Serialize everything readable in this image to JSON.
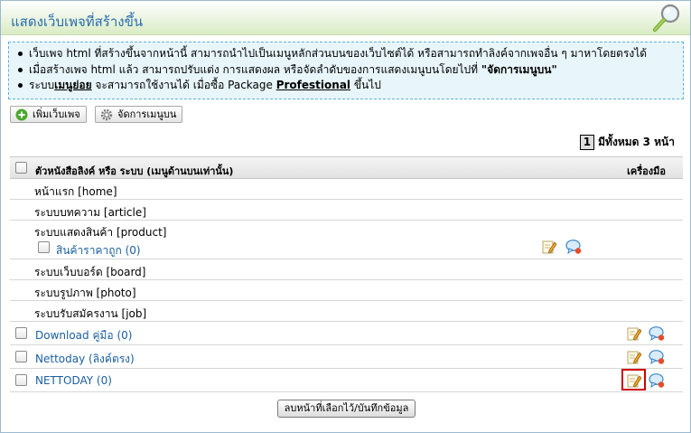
{
  "header": {
    "title": "แสดงเว็บเพจที่สร้างขึ้น",
    "icon": "magnifier-icon"
  },
  "info": {
    "line1": "เว็บเพจ html ที่สร้างขึ้นจากหน้านี้ สามารถนำไปเป็นเมนูหลักส่วนบนของเว็บไซต์ได้ หรือสามารถทำลิงค์จากเพจอื่น ๆ มาหาโดยตรงได้",
    "line2_prefix": "เมื่อสร้างเพจ html แล้ว สามารถปรับแต่ง การแสดงผล หรือจัดลำดับของการแสดงเมนูบนโดยไปที่",
    "line2_bold": "\"จัดการเมนูบน\"",
    "line3_a": "ระบบ",
    "line3_u1": "เมนูย่อย",
    "line3_b": " จะสามารถใช้งานได้ เมื่อซื้อ Package ",
    "line3_u2": "Profestional",
    "line3_c": " ขึ้นไป"
  },
  "toolbar": {
    "add_page_label": "เพิ่มเว็บเพจ",
    "manage_menu_label": "จัดการเมนูบน"
  },
  "pager": {
    "current_page": "1",
    "total_label": "มีทั้งหมด 3 หน้า"
  },
  "table": {
    "header_label": "ตัวหนังสือลิงค์ หรือ ระบบ (เมนูด้านบนเท่านั้น)",
    "header_tools": "เครื่องมือ",
    "rows": [
      {
        "label": "หน้าแรก [home]"
      },
      {
        "label": "ระบบบทความ [article]"
      },
      {
        "label": "ระบบแสดงสินค้า [product]",
        "sub_label": "สินค้าราคาถูก",
        "sub_count": "(0)"
      },
      {
        "label": "ระบบเว็บบอร์ด [board]"
      },
      {
        "label": "ระบบรูปภาพ [photo]"
      },
      {
        "label": "ระบบรับสมัครงาน [job]"
      },
      {
        "link": "Download คู่มือ",
        "extra": "(0)"
      },
      {
        "link": "Nettoday",
        "extra": "(ลิงค์ตรง)"
      },
      {
        "link": "NETTODAY",
        "extra": "(0)"
      }
    ]
  },
  "footer": {
    "submit_label": "ลบหน้าที่เลือกไว้/บันทึกข้อมูล"
  },
  "colors": {
    "title": "#2a6db0",
    "link": "#1b5fa0",
    "info_bg": "#e8f6fb",
    "info_border": "#5fb2d6",
    "highlight": "#d00000"
  }
}
